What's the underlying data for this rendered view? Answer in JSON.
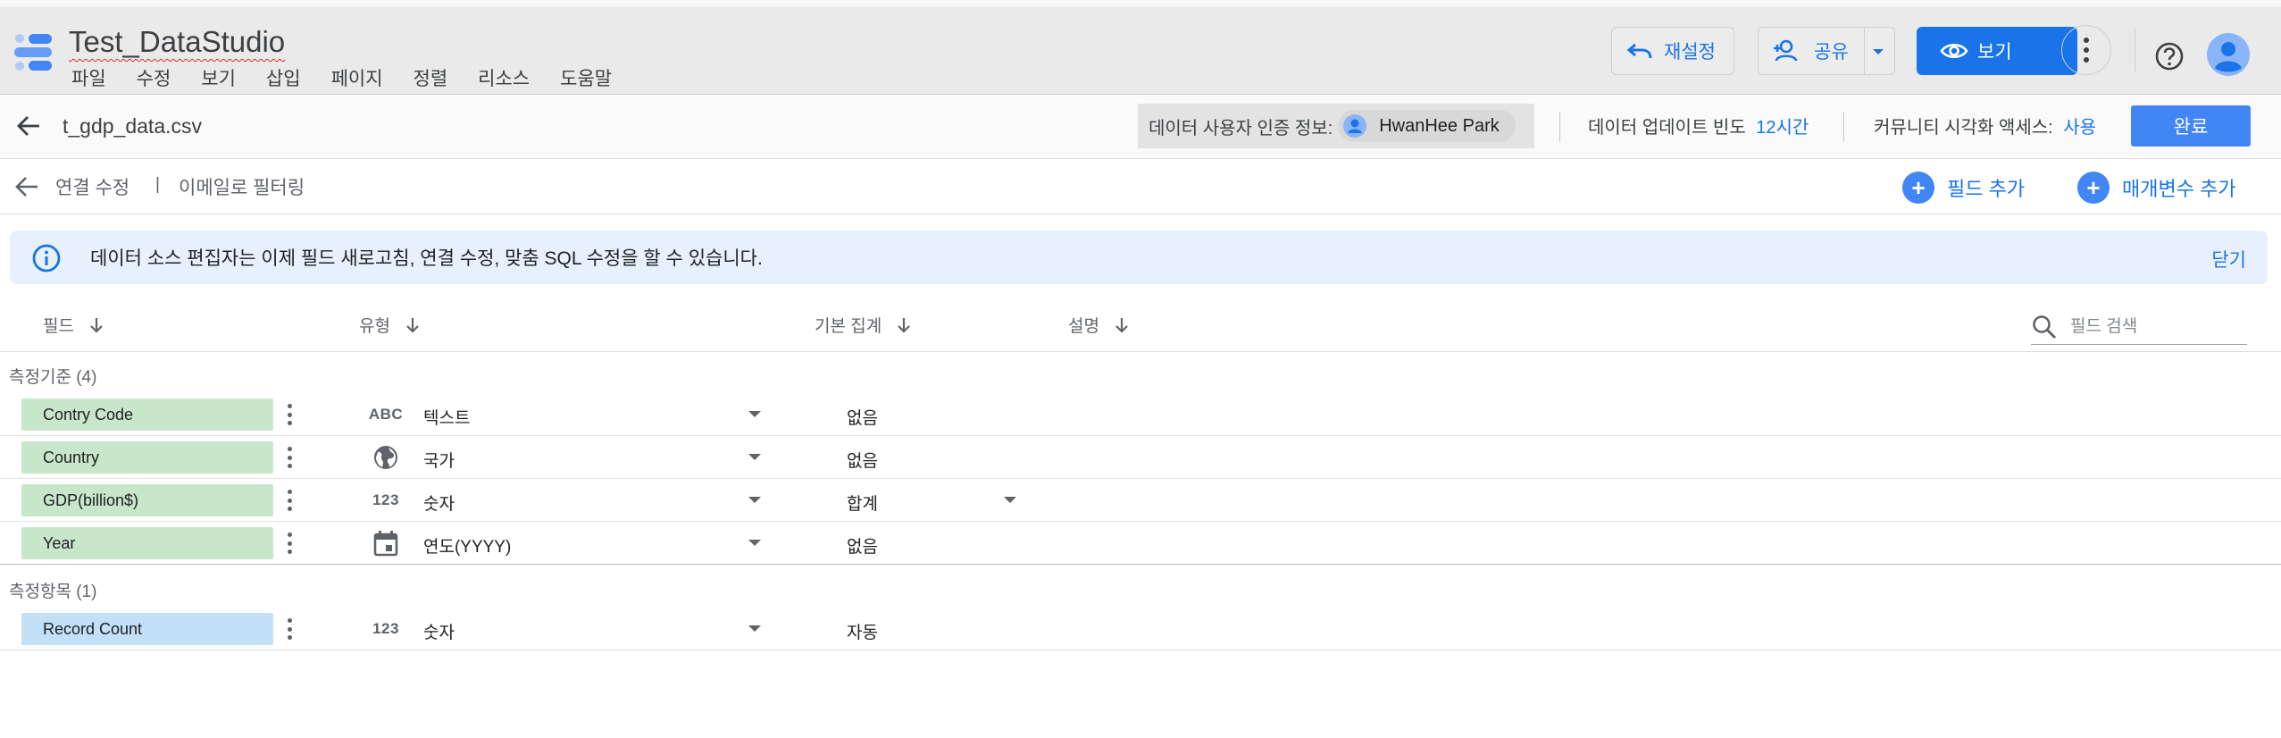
{
  "header": {
    "title": "Test_DataStudio",
    "menu": [
      "파일",
      "수정",
      "보기",
      "삽입",
      "페이지",
      "정렬",
      "리소스",
      "도움말"
    ],
    "reset_label": "재설정",
    "share_label": "공유",
    "view_label": "보기"
  },
  "databar": {
    "file_name": "t_gdp_data.csv",
    "credentials_label": "데이터 사용자 인증 정보:",
    "credentials_user": "HwanHee Park",
    "freshness_label": "데이터 업데이트 빈도",
    "freshness_value": "12시간",
    "community_label": "커뮤니티 시각화 액세스:",
    "community_value": "사용",
    "done_label": "완료"
  },
  "editbar": {
    "edit_connection": "연결 수정",
    "divider": "|",
    "email_filter": "이메일로 필터링",
    "add_field": "필드 추가",
    "add_parameter": "매개변수 추가"
  },
  "banner": {
    "text": "데이터 소스 편집자는 이제 필드 새로고침, 연결 수정, 맞춤 SQL 수정을 할 수 있습니다.",
    "close": "닫기"
  },
  "columns": {
    "field": "필드",
    "type": "유형",
    "aggregation": "기본 집계",
    "description": "설명",
    "search_placeholder": "필드 검색"
  },
  "dimensions": {
    "title": "측정기준 (4)",
    "rows": [
      {
        "name": "Contry Code",
        "type_icon": "ABC",
        "type": "텍스트",
        "aggregation": "없음"
      },
      {
        "name": "Country",
        "type_icon": "globe-icon",
        "type": "국가",
        "aggregation": "없음"
      },
      {
        "name": "GDP(billion$)",
        "type_icon": "123",
        "type": "숫자",
        "aggregation": "합계"
      },
      {
        "name": "Year",
        "type_icon": "calendar-icon",
        "type": "연도(YYYY)",
        "aggregation": "없음"
      }
    ]
  },
  "metrics": {
    "title": "측정항목 (1)",
    "rows": [
      {
        "name": "Record Count",
        "type_icon": "123",
        "type": "숫자",
        "aggregation": "자동"
      }
    ]
  },
  "colors": {
    "accent": "#1a73e8",
    "dimension_chip": "#c8e6c9",
    "metric_chip": "#c2e0f8",
    "banner_bg": "#e8f0fe"
  }
}
